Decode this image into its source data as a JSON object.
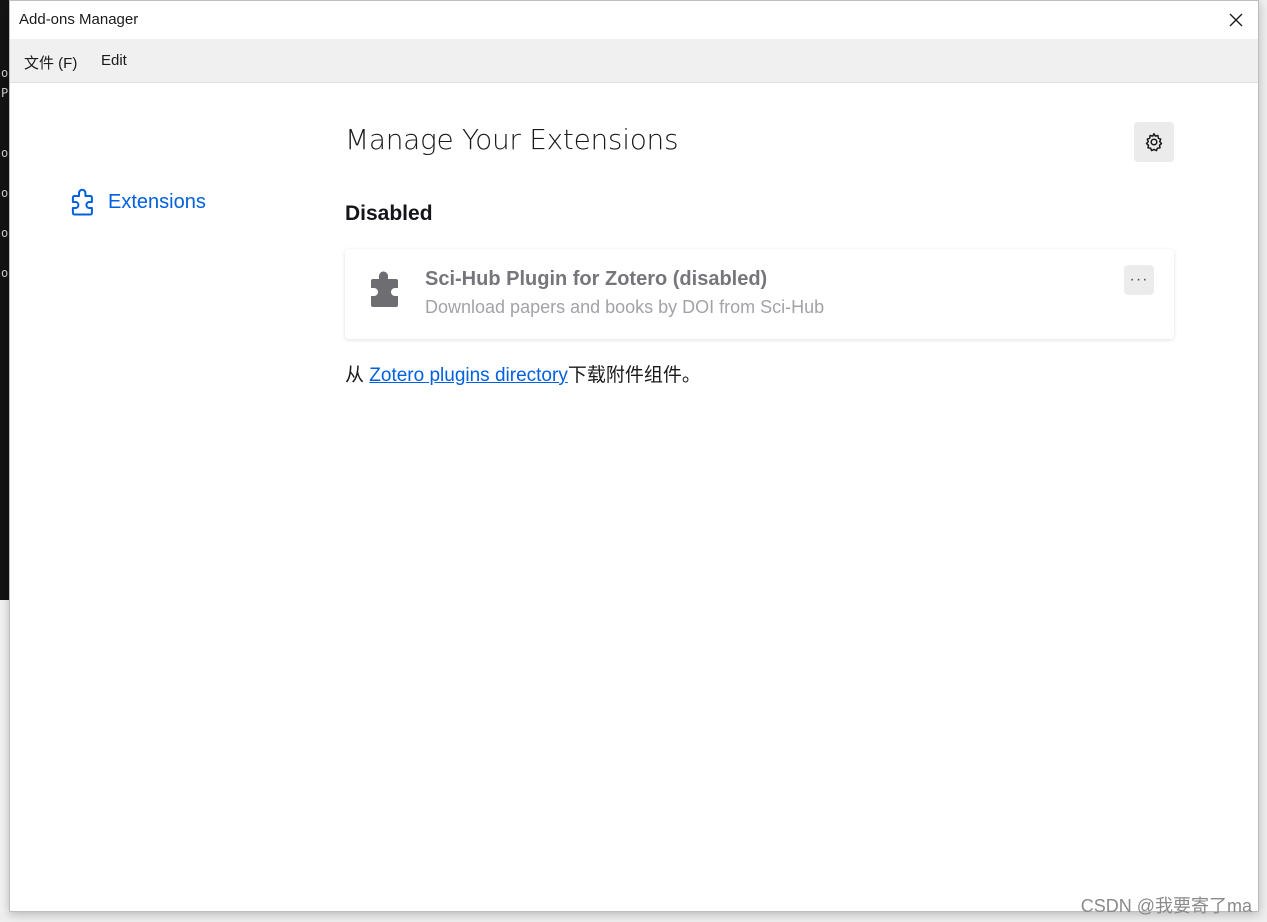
{
  "window": {
    "title": "Add-ons Manager"
  },
  "menubar": {
    "file_label": "文件 (F)",
    "edit_label": "Edit"
  },
  "sidebar": {
    "items": [
      {
        "label": "Extensions",
        "icon": "puzzle-outline-icon",
        "selected": true
      }
    ]
  },
  "main": {
    "heading": "Manage Your Extensions",
    "settings_icon": "gear-icon",
    "section_title": "Disabled",
    "addons": [
      {
        "name": "Sci-Hub Plugin for Zotero (disabled)",
        "description": "Download papers and books by DOI from Sci-Hub",
        "icon": "puzzle-icon",
        "menu_label": "···"
      }
    ],
    "footer": {
      "prefix": "从 ",
      "link_text": "Zotero plugins directory",
      "suffix": "下载附件组件。"
    }
  },
  "watermark": "CSDN @我要寄了ma",
  "colors": {
    "accent": "#0060df",
    "disabled_name": "#76757b",
    "disabled_desc": "#a3a2a8"
  }
}
